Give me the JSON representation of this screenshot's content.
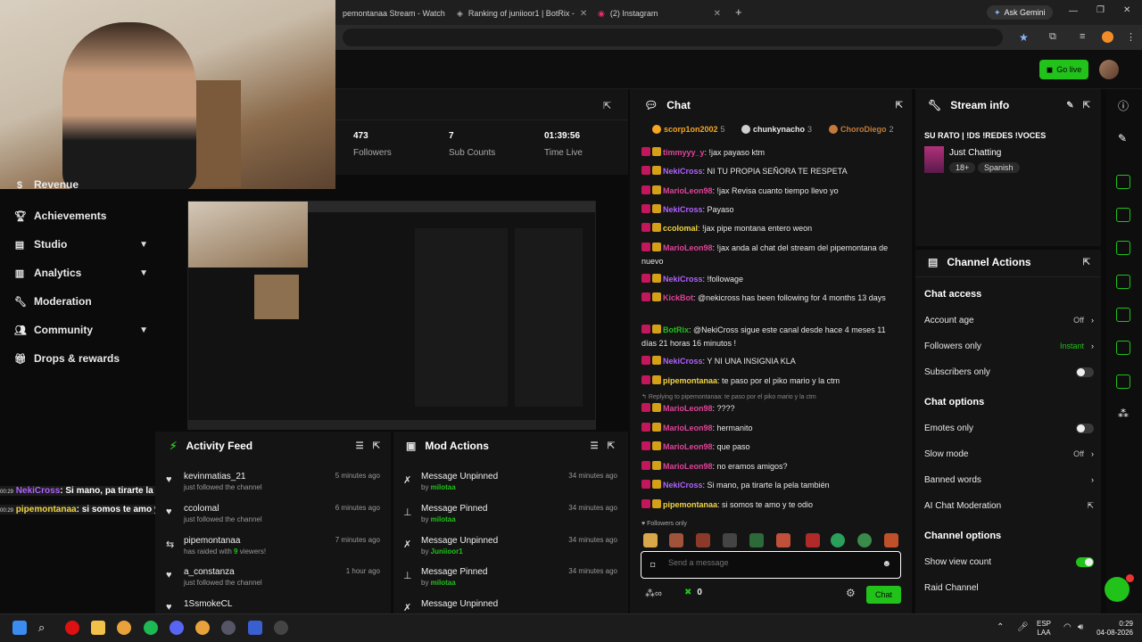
{
  "browser": {
    "tabs": [
      {
        "title": "pemontanaa Stream - Watch"
      },
      {
        "title": "Ranking of juniioor1 | BotRix -"
      },
      {
        "title": "(2) Instagram"
      }
    ],
    "ask_gemini": "Ask Gemini"
  },
  "topnav": {
    "go_live": "Go live"
  },
  "sidebar": {
    "items": [
      {
        "label": "Revenue",
        "icon": "dollar-icon"
      },
      {
        "label": "Achievements",
        "icon": "trophy-icon"
      },
      {
        "label": "Studio",
        "icon": "studio-icon",
        "expandable": true
      },
      {
        "label": "Analytics",
        "icon": "chart-icon",
        "expandable": true
      },
      {
        "label": "Moderation",
        "icon": "wrench-icon"
      },
      {
        "label": "Community",
        "icon": "people-icon",
        "expandable": true
      },
      {
        "label": "Drops & rewards",
        "icon": "gift-icon"
      }
    ]
  },
  "overlay_chat": [
    {
      "time": "00:29",
      "user": "NekiCross",
      "text": ": Si mano, pa tirarte la pela también"
    },
    {
      "time": "00:29",
      "user": "pipemontanaa",
      "text": ": si somos te amo y te odio"
    }
  ],
  "stats": [
    {
      "value": "473",
      "label": "Followers"
    },
    {
      "value": "7",
      "label": "Sub Counts"
    },
    {
      "value": "01:39:56",
      "label": "Time Live"
    }
  ],
  "activity_feed": {
    "title": "Activity Feed",
    "items": [
      {
        "icon": "heart-icon",
        "name": "kevinmatias_21",
        "sub": "just followed the channel",
        "time": "5 minutes ago"
      },
      {
        "icon": "heart-icon",
        "name": "ccolomal",
        "sub": "just followed the channel",
        "time": "6 minutes ago"
      },
      {
        "icon": "raid-icon",
        "name": "pipemontanaa",
        "sub_pre": "has raided with ",
        "sub_num": "9",
        "sub_post": " viewers!",
        "time": "7 minutes ago"
      },
      {
        "icon": "heart-icon",
        "name": "a_constanza",
        "sub": "just followed the channel",
        "time": "1 hour ago"
      },
      {
        "icon": "heart-icon",
        "name": "1SsmokeCL",
        "sub": "",
        "time": ""
      }
    ]
  },
  "mod_actions": {
    "title": "Mod Actions",
    "items": [
      {
        "action": "Message Unpinned",
        "by": "by ",
        "mod": "milotaa",
        "time": "34 minutes ago"
      },
      {
        "action": "Message Pinned",
        "by": "by ",
        "mod": "milotaa",
        "time": "34 minutes ago"
      },
      {
        "action": "Message Unpinned",
        "by": "by ",
        "mod": "Juniioor1",
        "time": "34 minutes ago"
      },
      {
        "action": "Message Pinned",
        "by": "by ",
        "mod": "milotaa",
        "time": "34 minutes ago"
      },
      {
        "action": "Message Unpinned",
        "by": "",
        "mod": "",
        "time": "34 minutes ago"
      }
    ]
  },
  "chat": {
    "title": "Chat",
    "leaderboard": [
      {
        "name": "scorp1on2002",
        "count": "5",
        "color": "#f5a623"
      },
      {
        "name": "chunkynacho",
        "count": "3",
        "color": "#cfcfcf"
      },
      {
        "name": "ChoroDiego",
        "count": "2",
        "color": "#c47a3a"
      }
    ],
    "messages": [
      {
        "user": "timmyyy_y",
        "color": "#e0439a",
        "text": ": !jax payaso ktm"
      },
      {
        "user": "NekiCross",
        "color": "#b062ff",
        "text": ": NI TU PROPIA SEÑORA TE RESPETA"
      },
      {
        "user": "MarioLeon98",
        "color": "#e0439a",
        "text": ": !jax Revisa cuanto tiempo llevo yo"
      },
      {
        "user": "NekiCross",
        "color": "#b062ff",
        "text": ": Payaso"
      },
      {
        "user": "ccolomal",
        "color": "#f2d544",
        "text": ": !jax pipe montana entero weon"
      },
      {
        "user": "MarioLeon98",
        "color": "#e0439a",
        "text": ": !jax anda al chat del stream del pipemontana de nuevo"
      },
      {
        "user": "NekiCross",
        "color": "#b062ff",
        "text": ": !followage"
      },
      {
        "user": "KickBot",
        "color": "#e0439a",
        "text": ": @nekicross has been following for 4 months 13 days"
      },
      {
        "user": "BotRix",
        "color": "#21c21a",
        "text": ": @NekiCross sigue este canal desde hace 4 meses 11 días 21 horas 16 minutos !"
      },
      {
        "user": "NekiCross",
        "color": "#b062ff",
        "text": ": Y NI UNA INSIGNIA KLA"
      },
      {
        "user": "pipemontanaa",
        "color": "#f2d544",
        "text": ": te paso por el piko mario y la ctm"
      },
      {
        "user": "MarioLeon98",
        "color": "#e0439a",
        "text": ": ????"
      },
      {
        "user": "MarioLeon98",
        "color": "#e0439a",
        "text": ": hermanito"
      },
      {
        "user": "MarioLeon98",
        "color": "#e0439a",
        "text": ": que paso"
      },
      {
        "user": "MarioLeon98",
        "color": "#e0439a",
        "text": ": no eramos amigos?"
      },
      {
        "user": "NekiCross",
        "color": "#b062ff",
        "text": ": Si mano, pa tirarte la pela también"
      },
      {
        "user": "pipemontanaa",
        "color": "#f2d544",
        "text": ": si somos te amo y te odio"
      }
    ],
    "reply_hint": "Replying to pipemontanaa: te paso por el piko mario y la ctm",
    "followers_only": "Followers only",
    "input_placeholder": "Send a message",
    "send_label": "Chat",
    "points": "0"
  },
  "stream_info": {
    "title": "Stream info",
    "stream_title": "SU RATO | !DS !REDES !VOCES",
    "category": "Just Chatting",
    "tags": [
      "18+",
      "Spanish"
    ]
  },
  "channel_actions": {
    "title": "Channel Actions",
    "sections": {
      "chat_access": "Chat access",
      "chat_options": "Chat options",
      "channel_options": "Channel options"
    },
    "rows": {
      "account_age": {
        "label": "Account age",
        "value": "Off"
      },
      "followers_only": {
        "label": "Followers only",
        "value": "Instant"
      },
      "subscribers_only": {
        "label": "Subscribers only"
      },
      "emotes_only": {
        "label": "Emotes only"
      },
      "slow_mode": {
        "label": "Slow mode",
        "value": "Off"
      },
      "banned_words": {
        "label": "Banned words"
      },
      "ai_moderation": {
        "label": "AI Chat Moderation"
      },
      "show_view_count": {
        "label": "Show view count"
      },
      "raid_channel": {
        "label": "Raid Channel"
      }
    }
  },
  "taskbar": {
    "lang_top": "ESP",
    "lang_bottom": "LAA",
    "time": "0:29",
    "date": "04-08-2026"
  },
  "colors": {
    "accent": "#21c21a",
    "panel": "#141414"
  }
}
